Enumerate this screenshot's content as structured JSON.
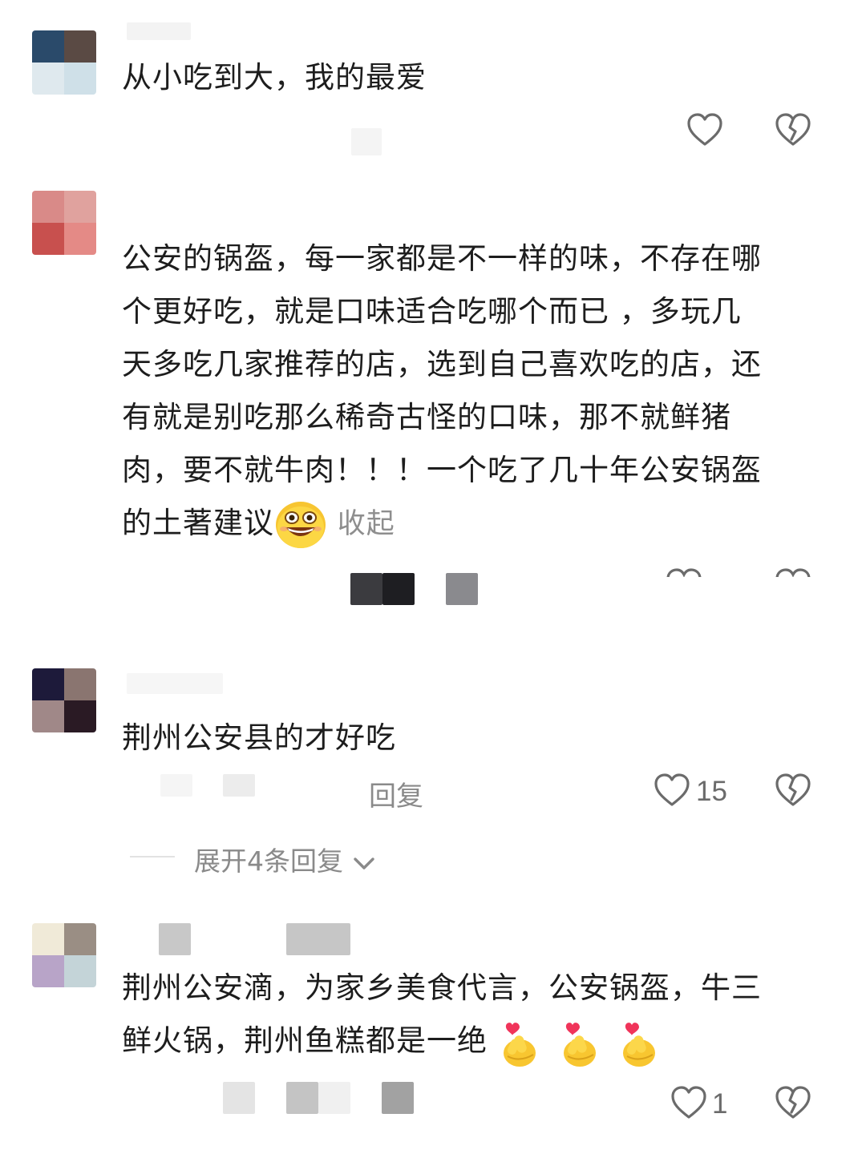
{
  "comments": [
    {
      "text": "从小吃到大，我的最爱",
      "like_count": "",
      "colors": [
        "#2a4a6a",
        "#5a4a44",
        "#dfe9ee",
        "#cfe0e8"
      ]
    },
    {
      "text_lines": [
        "公安的锅盔，每一家都是不一样的味，不存在哪",
        "个更好吃，就是口味适合吃哪个而已 ，多玩几",
        "天多吃几家推荐的店，选到自己喜欢吃的店，还",
        "有就是别吃那么稀奇古怪的口味，那不就鲜猪",
        "肉，要不就牛肉！！！一个吃了几十年公安锅盔",
        "的土著建议"
      ],
      "collapse_label": "收起",
      "emoji": "grinning-face-icon",
      "colors": [
        "#d98a88",
        "#e0a29e",
        "#c8504e",
        "#e48a86"
      ]
    },
    {
      "text": "荆州公安县的才好吃",
      "reply_label": "回复",
      "like_count": "15",
      "expand_label": "展开4条回复",
      "colors": [
        "#1d1a3a",
        "#8a7570",
        "#a08888",
        "#2a1a24"
      ]
    },
    {
      "text_lines": [
        "荆州公安滴，为家乡美食代言，公安锅盔，牛三",
        "鲜火锅，荆州鱼糕都是一绝"
      ],
      "emoji": "finger-heart-icon",
      "like_count": "1",
      "colors": [
        "#f0ead8",
        "#9a8e84",
        "#b8a4c8",
        "#c4d4d8"
      ]
    }
  ]
}
